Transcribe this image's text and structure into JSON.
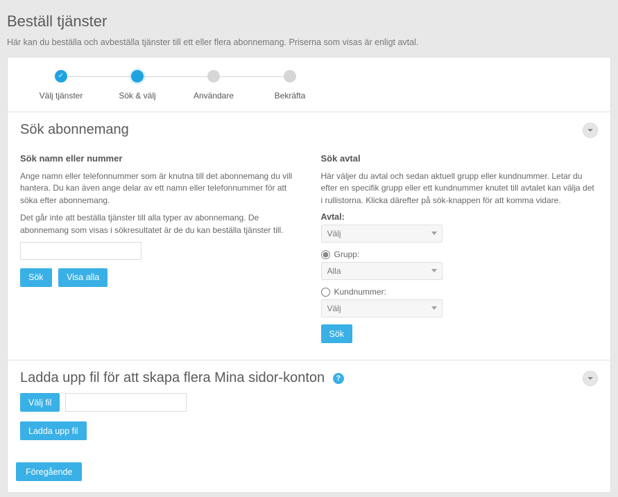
{
  "page": {
    "title": "Beställ tjänster",
    "description": "Här kan du beställa och avbeställa tjänster till ett eller flera abonnemang. Priserna som visas är enligt avtal."
  },
  "steps": [
    {
      "label": "Välj tjänster",
      "state": "done"
    },
    {
      "label": "Sök & välj",
      "state": "active"
    },
    {
      "label": "Användare",
      "state": "todo"
    },
    {
      "label": "Bekräfta",
      "state": "todo"
    }
  ],
  "search_section": {
    "title": "Sök abonnemang",
    "left": {
      "heading": "Sök namn eller nummer",
      "desc1": "Ange namn eller telefonnummer som är knutna till det abonnemang du vill hantera. Du kan även ange delar av ett namn eller telefonnummer för att söka efter abonnemang.",
      "desc2": "Det går inte att beställa tjänster till alla typer av abonnemang. De abonnemang som visas i sökresultatet är de du kan beställa tjänster till.",
      "input_value": "",
      "btn_search": "Sök",
      "btn_show_all": "Visa alla"
    },
    "right": {
      "heading": "Sök avtal",
      "desc": "Här väljer du avtal och sedan aktuell grupp eller kundnummer. Letar du efter en specifik grupp eller ett kundnummer knutet till avtalet kan välja det i rullistorna. Klicka därefter på sök-knappen för att komma vidare.",
      "avtal_label": "Avtal:",
      "avtal_selected": "Välj",
      "radio_group_label": "Grupp:",
      "group_selected": "Alla",
      "radio_kund_label": "Kundnummer:",
      "kund_selected": "Välj",
      "btn_search": "Sök"
    }
  },
  "upload_section": {
    "title": "Ladda upp fil för att skapa flera Mina sidor-konton",
    "btn_choose": "Välj fil",
    "btn_upload": "Ladda upp fil",
    "file_value": ""
  },
  "footer": {
    "btn_prev": "Föregående"
  }
}
